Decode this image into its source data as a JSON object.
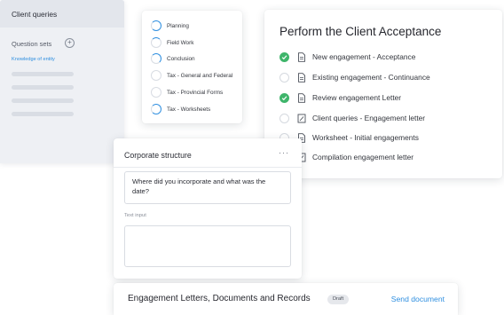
{
  "phases": [
    {
      "label": "Planning",
      "progress": 0.75
    },
    {
      "label": "Field Work",
      "progress": 0.25
    },
    {
      "label": "Conclusion",
      "progress": 0.5
    },
    {
      "label": "Tax - General and Federal",
      "progress": 0
    },
    {
      "label": "Tax - Provincial Forms",
      "progress": 0
    },
    {
      "label": "Tax - Worksheets",
      "progress": 0.85
    }
  ],
  "acceptance": {
    "title": "Perform the Client Acceptance",
    "tasks": [
      {
        "label": "New engagement - Acceptance",
        "status": "done",
        "icon": "document-icon"
      },
      {
        "label": "Existing engagement - Continuance",
        "status": "todo",
        "icon": "document-icon"
      },
      {
        "label": "Review engagement Letter",
        "status": "done",
        "icon": "document-icon"
      },
      {
        "label": "Client queries - Engagement letter",
        "status": "todo",
        "icon": "edit-document-icon"
      },
      {
        "label": "Worksheet - Initial engagements",
        "status": "todo",
        "icon": "document-icon"
      },
      {
        "label": "Compilation engagement letter",
        "status": "todo",
        "icon": "edit-document-icon"
      }
    ]
  },
  "queries": {
    "title": "Client queries",
    "question_sets": "Question sets",
    "add_symbol": "+",
    "active_set": "Knowledge of entity"
  },
  "corporate": {
    "title": "Corporate structure",
    "more": "···",
    "question": "Where did you incorporate and what was the date?",
    "text_input_label": "Text input",
    "text_input_value": ""
  },
  "engagement": {
    "title": "Engagement Letters, Documents and Records",
    "badge": "Draft",
    "action": "Send document"
  },
  "colors": {
    "accent": "#2f8fe0",
    "done": "#3fb56b"
  }
}
